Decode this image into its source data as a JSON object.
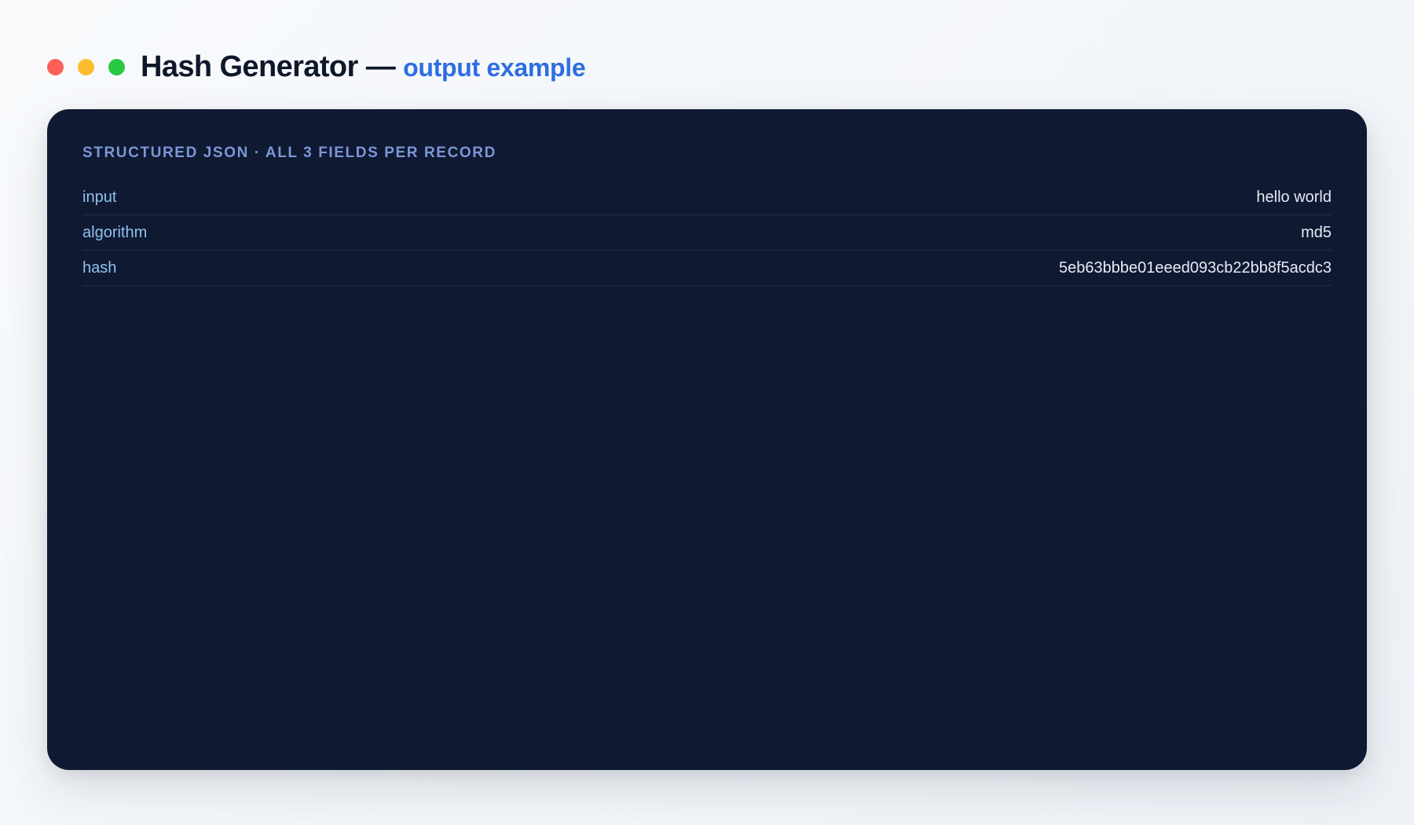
{
  "window": {
    "controls": [
      "close",
      "minimize",
      "maximize"
    ],
    "colors": {
      "close": "#ff5f57",
      "minimize": "#febc2e",
      "maximize": "#28c840"
    }
  },
  "header": {
    "title": "Hash Generator",
    "separator": "—",
    "subtitle": "output example"
  },
  "panel": {
    "heading": "STRUCTURED JSON · ALL 3 FIELDS PER RECORD",
    "rows": [
      {
        "key": "input",
        "value": "hello world"
      },
      {
        "key": "algorithm",
        "value": "md5"
      },
      {
        "key": "hash",
        "value": "5eb63bbbe01eeed093cb22bb8f5acdc3"
      }
    ]
  },
  "colors": {
    "accent": "#2d6ee0",
    "panel_background": "#0f1932",
    "key_text": "#8fc1f0",
    "value_text": "#e6ebf4",
    "heading_text": "#7c97d6"
  }
}
